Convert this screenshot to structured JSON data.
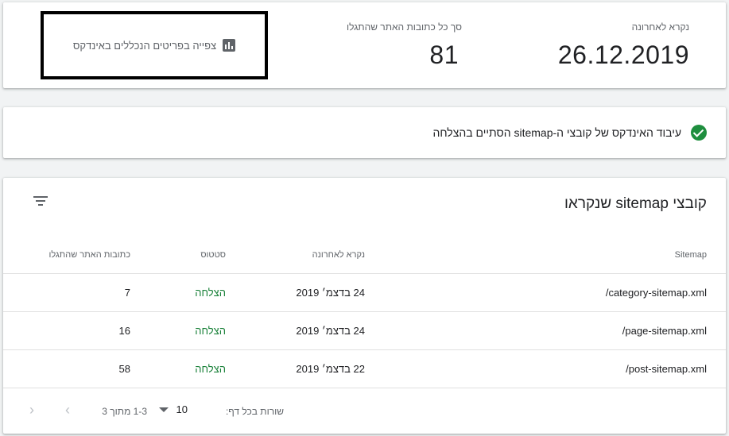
{
  "stats": {
    "last_read_label": "נקרא לאחרונה",
    "last_read_value": "26.12.2019",
    "discovered_label": "סך כל כתובות האתר שהתגלו",
    "discovered_value": "81",
    "view_indexed_label": "צפייה בפריטים הנכללים באינדקס"
  },
  "status_banner": {
    "text": "עיבוד האינדקס של קובצי ה-sitemap הסתיים בהצלחה",
    "color": "#1e8e3e"
  },
  "table": {
    "title": "קובצי sitemap שנקראו",
    "columns": {
      "sitemap": "Sitemap",
      "last_read": "נקרא לאחרונה",
      "status": "סטטוס",
      "discovered": "כתובות האתר שהתגלו"
    },
    "rows": [
      {
        "sitemap": "/category-sitemap.xml",
        "last_read": "24 בדצמ׳ 2019",
        "status": "הצלחה",
        "discovered": "7"
      },
      {
        "sitemap": "/page-sitemap.xml",
        "last_read": "24 בדצמ׳ 2019",
        "status": "הצלחה",
        "discovered": "16"
      },
      {
        "sitemap": "/post-sitemap.xml",
        "last_read": "22 בדצמ׳ 2019",
        "status": "הצלחה",
        "discovered": "58"
      }
    ]
  },
  "pagination": {
    "rows_per_page_label": "שורות בכל דף:",
    "rows_per_page_value": "10",
    "range_text": "1-3 מתוך 3",
    "next_icon": "chevron-right-icon",
    "prev_icon": "chevron-left-icon"
  },
  "colors": {
    "success": "#188038",
    "accent": "#1e8e3e"
  }
}
